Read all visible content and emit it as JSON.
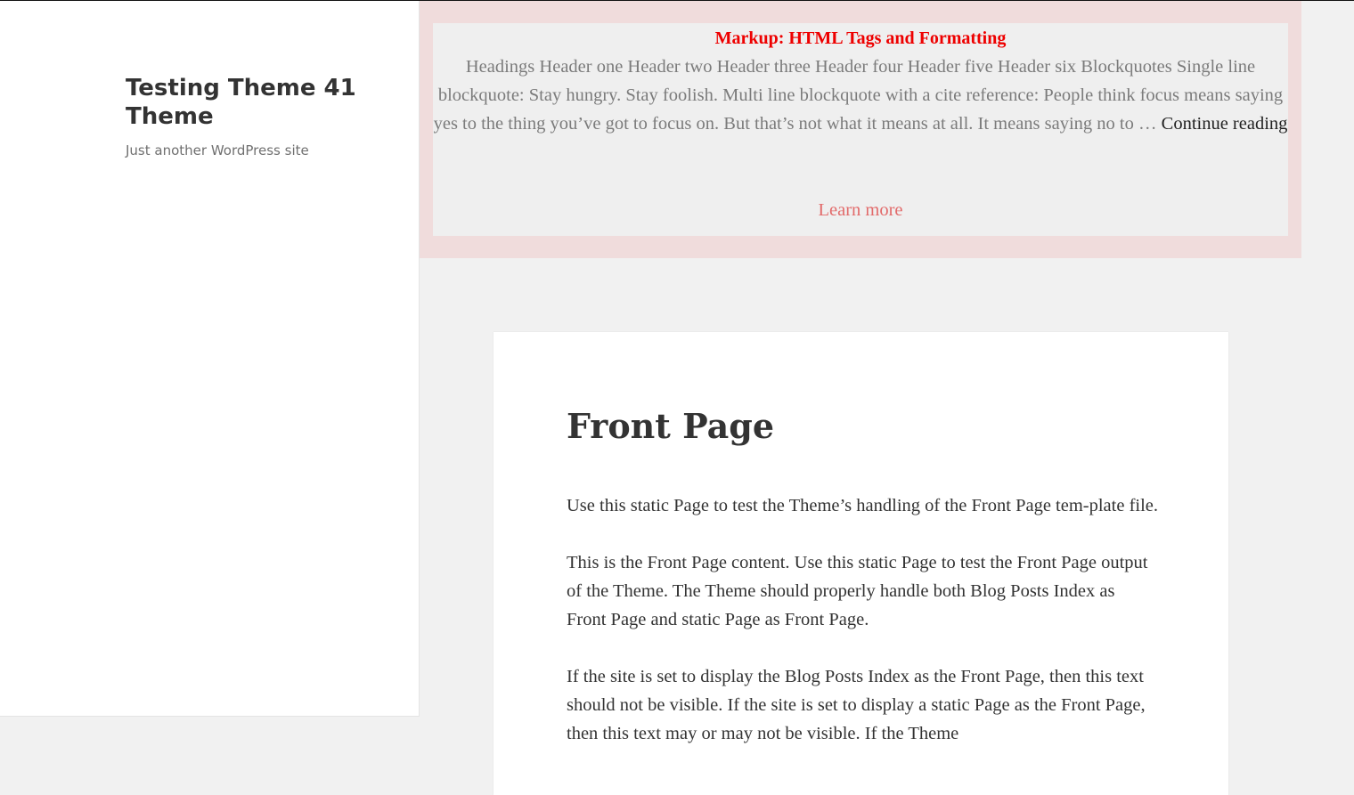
{
  "site": {
    "title": "Testing Theme 41 Theme",
    "description": "Just another WordPress site"
  },
  "featured": {
    "title": "Markup: HTML Tags and Formatting",
    "excerpt": "Headings Header one Header two Header three Header four Header five Header six Blockquotes Single line blockquote: Stay hungry. Stay foolish. Multi line blockquote with a cite reference: People think focus means saying yes to the thing you’ve got to focus on. But that’s not what it means at all. It means saying no to …",
    "continue_label": "Continue reading",
    "learn_more_label": "Learn more",
    "colors": {
      "title": "#ee0000",
      "learn_more": "#e26a6a",
      "banner_background": "#f0dcdc"
    }
  },
  "page": {
    "title": "Front Page",
    "paragraphs": [
      "Use this static Page to test the Theme’s handling of the Front Page tem-plate file.",
      "This is the Front Page content. Use this static Page to test the Front Page output of the Theme. The Theme should properly handle both Blog Posts Index as Front Page and static Page as Front Page.",
      "If the site is set to display the Blog Posts Index as the Front Page, then this text should not be visible. If the site is set to display a static Page as the Front Page, then this text may or may not be visible. If the Theme"
    ]
  }
}
